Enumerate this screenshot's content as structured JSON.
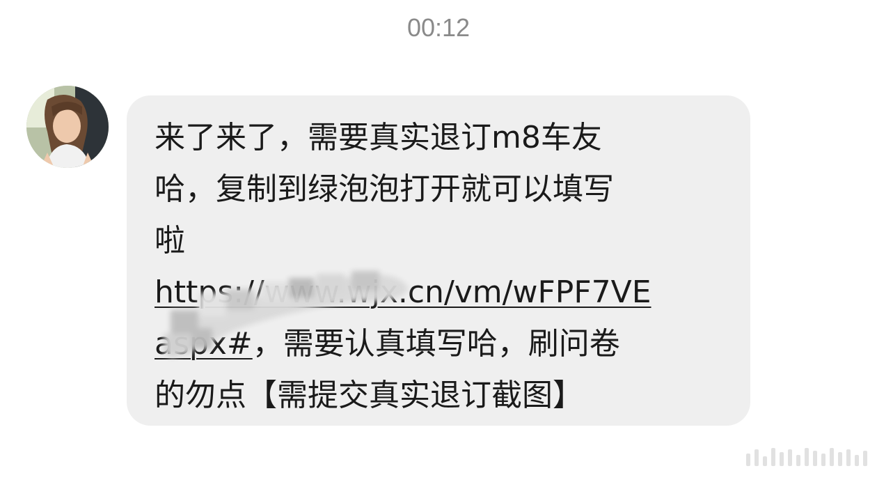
{
  "conversation": {
    "timestamp": "00:12"
  },
  "message": {
    "sender_avatar": "user-avatar",
    "lines": [
      "来了来了，需要真实退订m8车友",
      "哈，复制到绿泡泡打开就可以填写",
      "啦"
    ],
    "link_line_1": "https://www.wjx.cn/vm/wFPF7VE",
    "link_line_2_link": "aspx#",
    "link_line_2_rest": "，需要认真填写哈，刷问卷",
    "last_line": "的勿点【需提交真实退订截图】"
  },
  "colors": {
    "bubble": "#efefef",
    "timestamp": "#8a8a8a",
    "text": "#1a1a1a"
  }
}
